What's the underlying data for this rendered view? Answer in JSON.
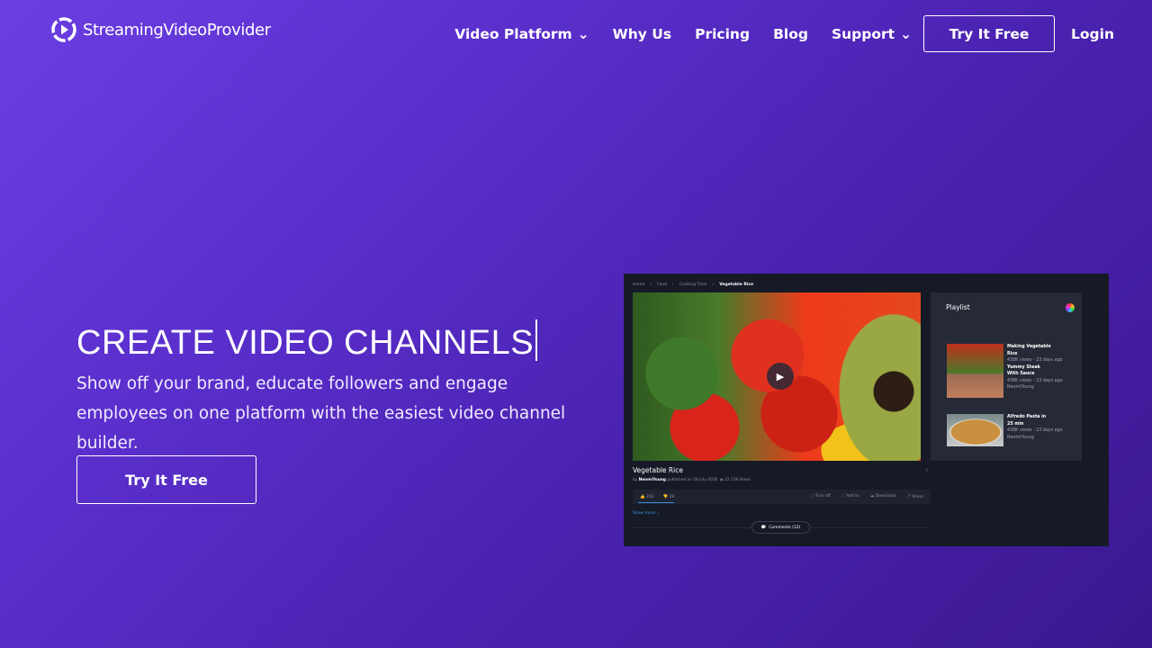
{
  "brand": {
    "name": "StreamingVideoProvider"
  },
  "nav": {
    "items": [
      {
        "label": "Video Platform",
        "dropdown": true
      },
      {
        "label": "Why Us"
      },
      {
        "label": "Pricing"
      },
      {
        "label": "Blog"
      },
      {
        "label": "Support",
        "dropdown": true
      }
    ],
    "try_label": "Try It Free",
    "login_label": "Login"
  },
  "hero": {
    "title": "CREATE VIDEO CHANNELS",
    "subtitle": "Show off your brand, educate followers and engage employees on one platform with the easiest video channel builder.",
    "cta": "Try It Free"
  },
  "mockup": {
    "breadcrumb": [
      "Home",
      "Food",
      "Cooking Time",
      "Vegetable Rice"
    ],
    "video_title": "Vegetable Rice",
    "by": "by",
    "author": "NeomiYoung",
    "published": "published on 28 July 2018",
    "views": "22 158 Views",
    "likes": "202",
    "dislikes": "29",
    "actions": [
      "Turn off",
      "Add to",
      "Download",
      "Share"
    ],
    "show_more": "Show more ⌄",
    "comments": "Comments (12)",
    "playlist": {
      "title": "Playlist",
      "items": [
        {
          "title": "Making Vegetable Rice",
          "meta": "438K views - 23 days ago"
        },
        {
          "title": "Yummy Steak With Sauce",
          "meta": "438K views - 23 days ago",
          "author": "NeomiYoung"
        },
        {
          "title": "Alfredo Pasta in 25 min",
          "meta": "438K views - 23 days ago",
          "author": "NeomiYoung"
        }
      ]
    }
  },
  "colors": {
    "bg_start": "#6b3ee2",
    "bg_end": "#3a1890",
    "mock_bg": "#161a26",
    "link": "#3a9ae0"
  }
}
